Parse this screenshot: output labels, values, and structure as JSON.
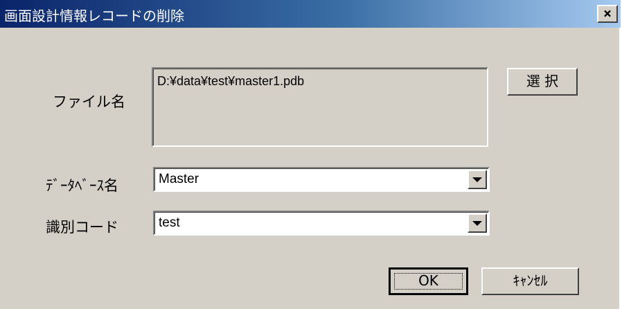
{
  "window": {
    "title": "画面設計情報レコードの削除",
    "close_label": "×"
  },
  "form": {
    "file_label": "ファイル名",
    "file_value": "D:¥data¥test¥master1.pdb",
    "select_button": "選 択",
    "database_label": "ﾃﾞｰﾀﾍﾞｰｽ名",
    "database_value": "Master",
    "id_code_label": "識別コード",
    "id_code_value": "test"
  },
  "buttons": {
    "ok": "OK",
    "cancel": "ｷｬﾝｾﾙ"
  },
  "colors": {
    "title_gradient_start": "#0a246a",
    "title_gradient_end": "#a6caf0",
    "face": "#d4d0c8"
  }
}
